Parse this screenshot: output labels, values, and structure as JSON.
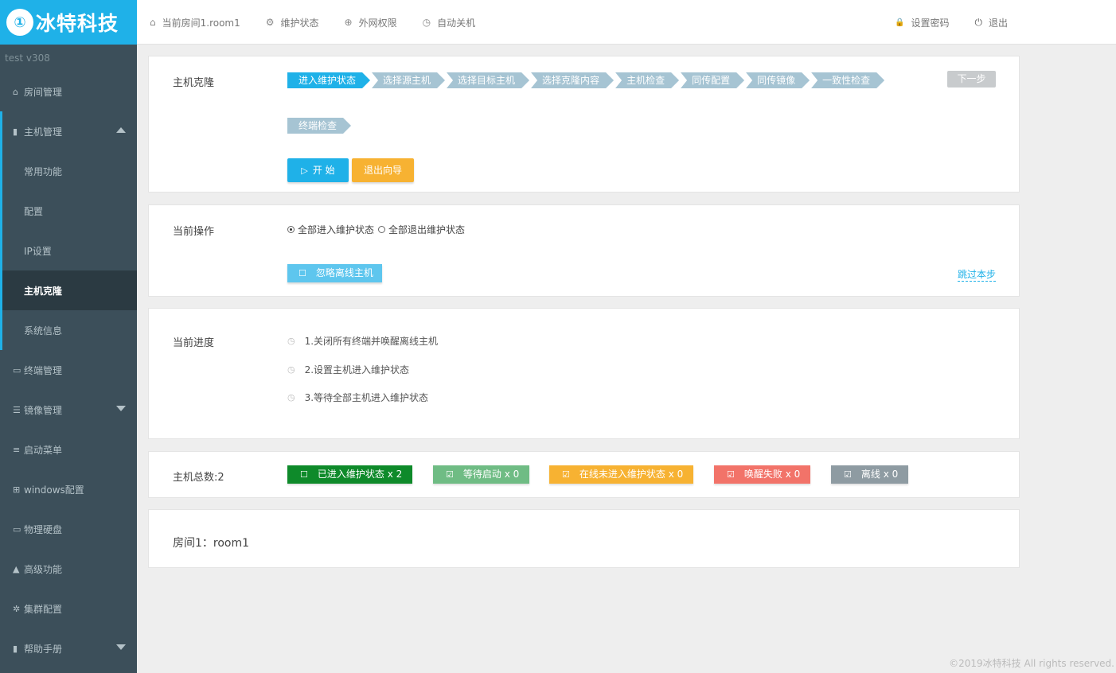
{
  "brand": {
    "logo_mark": "①",
    "name": "冰特科技"
  },
  "header": {
    "nav": [
      {
        "icon": "⌂",
        "label": "当前房间1.room1"
      },
      {
        "icon": "⚙",
        "label": "维护状态"
      },
      {
        "icon": "⊕",
        "label": "外网权限"
      },
      {
        "icon": "◷",
        "label": "自动关机"
      }
    ],
    "right": [
      {
        "icon": "🔒",
        "label": "设置密码"
      },
      {
        "icon": "⏻",
        "label": "退出"
      }
    ]
  },
  "sidebar": {
    "version": "test  v308",
    "room_mgmt": {
      "icon": "⌂",
      "label": "房间管理"
    },
    "host_mgmt": {
      "icon": "▮",
      "label": "主机管理"
    },
    "sub_items": [
      "常用功能",
      "配置",
      "IP设置",
      "主机克隆",
      "系统信息"
    ],
    "terminal_mgmt": {
      "icon": "▭",
      "label": "终端管理"
    },
    "image_mgmt": {
      "icon": "☰",
      "label": "镜像管理"
    },
    "boot_menu": {
      "icon": "≡",
      "label": "启动菜单"
    },
    "windows_cfg": {
      "icon": "⊞",
      "label": "windows配置"
    },
    "disk": {
      "icon": "▭",
      "label": "物理硬盘"
    },
    "advanced": {
      "icon": "▲",
      "label": "高级功能"
    },
    "cluster": {
      "icon": "✲",
      "label": "集群配置"
    },
    "help": {
      "icon": "▮",
      "label": "帮助手册"
    }
  },
  "clone": {
    "label": "主机克隆",
    "steps": [
      "进入维护状态",
      "选择源主机",
      "选择目标主机",
      "选择克隆内容",
      "主机检查",
      "同传配置",
      "同传镜像",
      "一致性检查"
    ],
    "step_last": "终端检查",
    "next": "下一步",
    "start_icon": "▷",
    "start": "开 始",
    "exit": "退出向导"
  },
  "operation": {
    "label": "当前操作",
    "radio1": "全部进入维护状态",
    "radio2": "全部退出维护状态",
    "ignore_icon": "☐",
    "ignore": "忽略离线主机",
    "skip": "跳过本步"
  },
  "progress": {
    "label": "当前进度",
    "icon": "◷",
    "items": [
      "1.关闭所有终端并唤醒离线主机",
      "2.设置主机进入维护状态",
      "3.等待全部主机进入维护状态"
    ]
  },
  "hosts": {
    "label": "主机总数:2",
    "stats": [
      {
        "icon": "☐",
        "label": "已进入维护状态 x 2",
        "color": "#0e8a2a"
      },
      {
        "icon": "☑",
        "label": "等待启动 x 0",
        "color": "#6fbc84"
      },
      {
        "icon": "☑",
        "label": "在线未进入维护状态 x 0",
        "color": "#f7b232"
      },
      {
        "icon": "☑",
        "label": "唤醒失败 x 0",
        "color": "#f27369"
      },
      {
        "icon": "☑",
        "label": "离线 x 0",
        "color": "#8e9ba2"
      }
    ]
  },
  "room": {
    "label": "房间1：room1"
  },
  "footer": "©2019冰特科技 All rights reserved."
}
